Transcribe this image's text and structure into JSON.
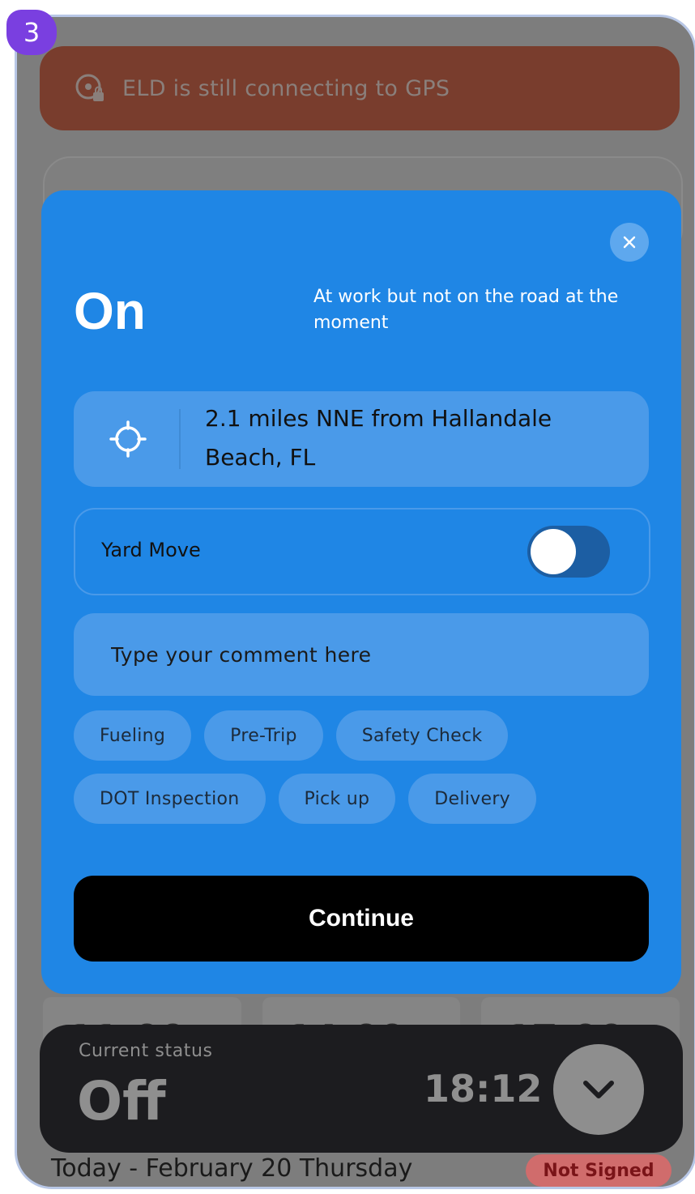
{
  "step_badge": "3",
  "gps_banner": {
    "text": "ELD is still connecting to GPS",
    "icon": "gps-lock-icon"
  },
  "background_cells": [
    "11:00",
    "14:00",
    "17:00"
  ],
  "modal": {
    "close_icon": "close-icon",
    "status_title": "On",
    "status_description": "At work but not on the road at the moment",
    "location": {
      "icon": "crosshair-icon",
      "text": "2.1 miles NNE from Hallandale Beach, FL"
    },
    "yard_move": {
      "label": "Yard Move",
      "enabled": false
    },
    "comment": {
      "placeholder": "Type your comment here",
      "value": ""
    },
    "chips": [
      [
        "Fueling",
        "Pre-Trip",
        "Safety Check"
      ],
      [
        "DOT Inspection",
        "Pick up",
        "Delivery"
      ]
    ],
    "continue_label": "Continue"
  },
  "status_bar": {
    "label": "Current status",
    "value": "Off",
    "time": "18:12",
    "expand_icon": "chevron-down-icon"
  },
  "date_row": {
    "text": "Today - February 20 Thursday",
    "badge": "Not Signed"
  },
  "colors": {
    "modal_bg": "#1f86e5",
    "chip_bg": "#4a9ae9",
    "continue_bg": "#000000",
    "gps_banner_bg": "#793d2d",
    "status_bar_bg": "#1c1c1f",
    "badge": "#7a3fe0"
  }
}
